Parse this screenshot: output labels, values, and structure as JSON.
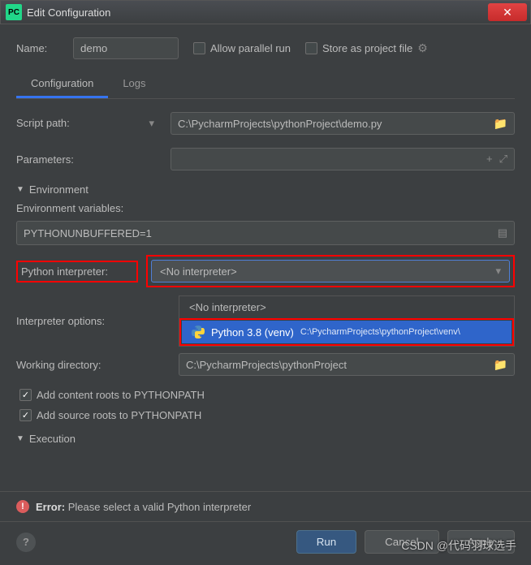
{
  "titlebar": {
    "title": "Edit Configuration",
    "close": "X"
  },
  "name": {
    "label": "Name:",
    "value": "demo"
  },
  "allow_parallel": "Allow parallel run",
  "store_project": "Store as project file",
  "tabs": {
    "config": "Configuration",
    "logs": "Logs"
  },
  "script": {
    "label": "Script path:",
    "value": "C:\\PycharmProjects\\pythonProject\\demo.py"
  },
  "params": {
    "label": "Parameters:"
  },
  "env": {
    "header": "Environment",
    "vars_label": "Environment variables:",
    "vars_value": "PYTHONUNBUFFERED=1",
    "interp_label": "Python interpreter:",
    "interp_value": "<No interpreter>",
    "interp_opts_label": "Interpreter options:",
    "workdir_label": "Working directory:",
    "workdir_value": "C:\\PycharmProjects\\pythonProject",
    "add_content": "Add content roots to PYTHONPATH",
    "add_source": "Add source roots to PYTHONPATH"
  },
  "dropdown": {
    "none": "<No interpreter>",
    "py38_name": "Python 3.8 (venv)",
    "py38_path": "C:\\PycharmProjects\\pythonProject\\venv\\"
  },
  "execution": "Execution",
  "error": {
    "label": "Error:",
    "msg": "Please select a valid Python interpreter"
  },
  "buttons": {
    "run": "Run",
    "cancel": "Cancel",
    "apply": "Apply"
  },
  "watermark": "CSDN @代码羽球选手"
}
